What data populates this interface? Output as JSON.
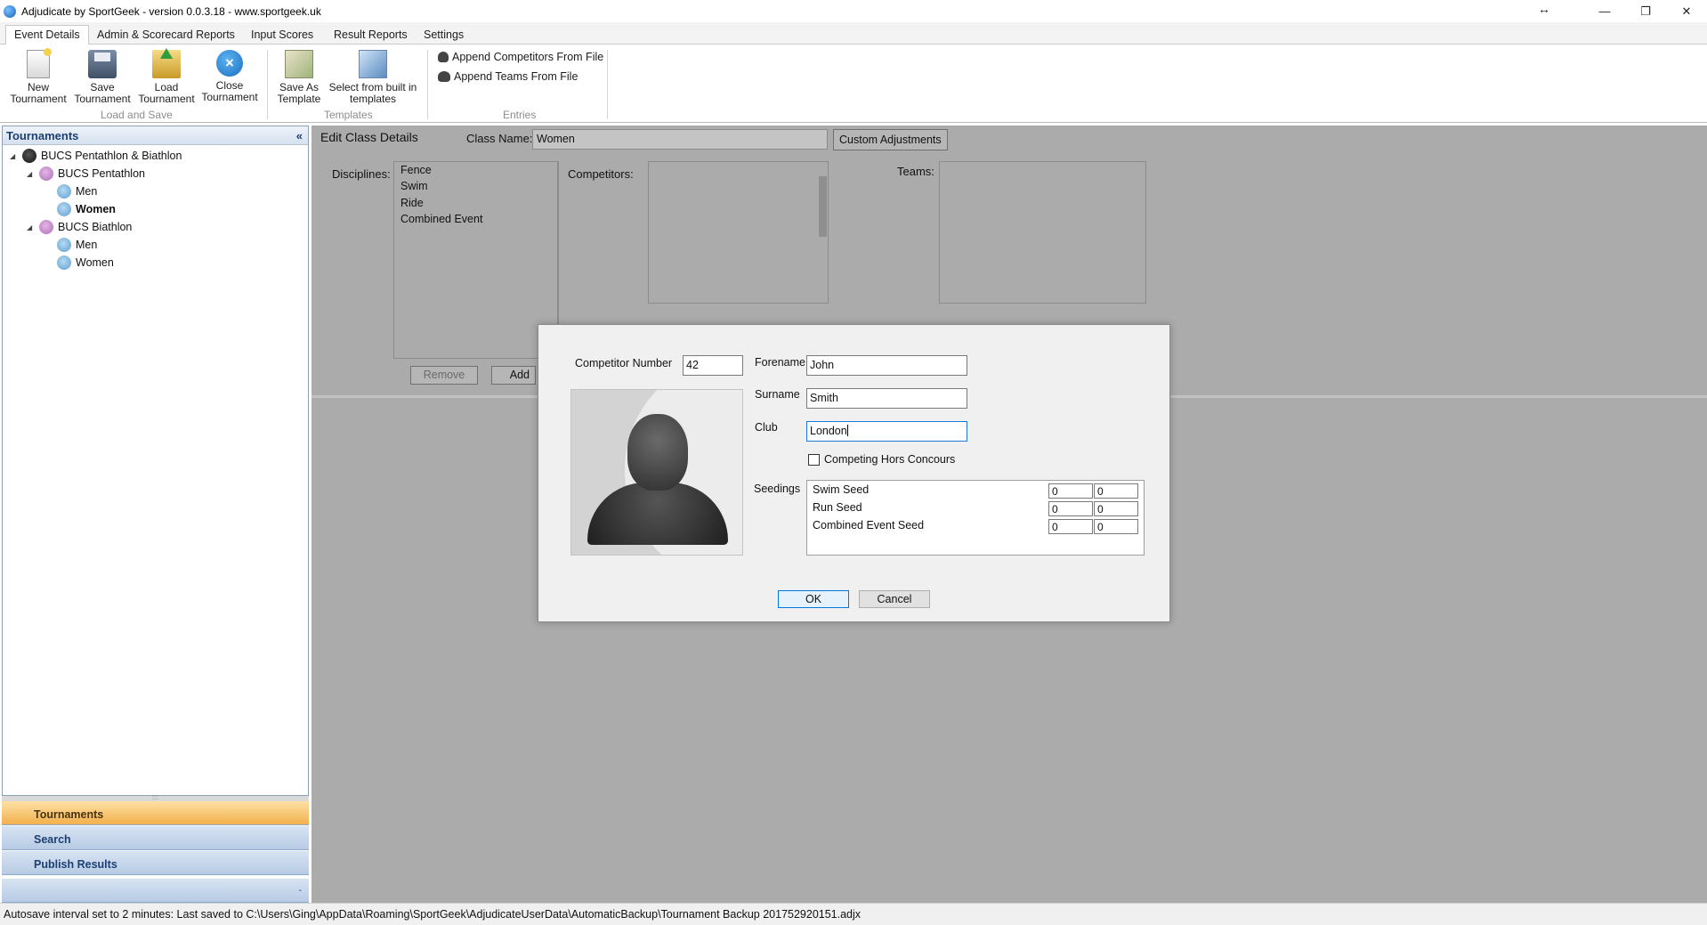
{
  "window": {
    "title": "Adjudicate by SportGeek -  version 0.0.3.18 - www.sportgeek.uk",
    "resize_glyph": "↔",
    "minimize": "—",
    "maximize": "❐",
    "close": "✕"
  },
  "ribbon": {
    "tabs": [
      {
        "label": "Event Details",
        "active": true
      },
      {
        "label": "Admin & Scorecard Reports",
        "active": false
      },
      {
        "label": "Input Scores",
        "active": false
      },
      {
        "label": "Result Reports",
        "active": false
      },
      {
        "label": "Settings",
        "active": false
      }
    ],
    "buttons": {
      "new_tournament": "New Tournament",
      "save_tournament": "Save Tournament",
      "load_tournament": "Load Tournament",
      "close_tournament": "Close Tournament",
      "save_as_template": "Save As Template",
      "select_templates": "Select from built in templates"
    },
    "close_glyph": "×",
    "links": {
      "append_competitors": "Append Competitors From File",
      "append_teams": "Append Teams From File"
    },
    "groups": {
      "load_and_save": "Load and Save",
      "templates": "Templates",
      "entries": "Entries"
    }
  },
  "left_panel": {
    "title": "Tournaments",
    "collapse_glyph": "«",
    "tree": {
      "root": "BUCS Pentathlon & Biathlon",
      "pentathlon": "BUCS Pentathlon",
      "pentathlon_men": "Men",
      "pentathlon_women": "Women",
      "biathlon": "BUCS Biathlon",
      "biathlon_men": "Men",
      "biathlon_women": "Women",
      "expanded_glyph": "◢"
    },
    "grip_glyph": "::::",
    "nav": {
      "tournaments": "Tournaments",
      "search": "Search",
      "publish_results": "Publish Results",
      "footer_glyph": "-"
    }
  },
  "main": {
    "heading": "Edit Class Details",
    "class_name_label": "Class Name:",
    "class_name_value": "Women",
    "custom_adjustments": "Custom Adjustments",
    "disciplines_label": "Disciplines:",
    "disciplines": [
      "Fence",
      "Swim",
      "Ride",
      "Combined Event"
    ],
    "competitors_label": "Competitors:",
    "teams_label": "Teams:",
    "remove_button": "Remove",
    "add_button": "Add"
  },
  "dialog": {
    "competitor_number_label": "Competitor Number",
    "competitor_number": "42",
    "forename_label": "Forename",
    "forename": "John",
    "surname_label": "Surname",
    "surname": "Smith",
    "club_label": "Club",
    "club": "London",
    "hors_concours_label": "Competing Hors Concours",
    "hors_concours_checked": false,
    "seedings_label": "Seedings",
    "seedings": [
      {
        "name": "Swim Seed",
        "value1": "0",
        "value2": "0"
      },
      {
        "name": "Run Seed",
        "value1": "0",
        "value2": "0"
      },
      {
        "name": "Combined Event Seed",
        "value1": "0",
        "value2": "0"
      }
    ],
    "ok": "OK",
    "cancel": "Cancel"
  },
  "status_bar": {
    "text": "Autosave interval set to 2 minutes: Last saved to C:\\Users\\Ging\\AppData\\Roaming\\SportGeek\\AdjudicateUserData\\AutomaticBackup\\Tournament Backup 201752920151.adjx"
  }
}
